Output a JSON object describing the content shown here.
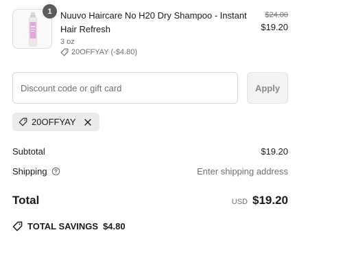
{
  "product": {
    "quantity": "1",
    "title": "Nuuvo Haircare No H20 Dry Shampoo - Instant Hair Refresh",
    "variant": "3 oz",
    "discount_line": "20OFFYAY (-$4.80)",
    "price_original": "$24.00",
    "price_current": "$19.20",
    "thumbnail_icon": "dry-shampoo-bottle"
  },
  "discount_form": {
    "placeholder": "Discount code or gift card",
    "value": "",
    "apply_label": "Apply"
  },
  "applied_code": {
    "code": "20OFFYAY",
    "remove_icon": "close-icon"
  },
  "summary": {
    "subtotal_label": "Subtotal",
    "subtotal_value": "$19.20",
    "shipping_label": "Shipping",
    "shipping_value": "Enter shipping address",
    "total_label": "Total",
    "currency": "USD",
    "total_value": "$19.20",
    "savings_label": "TOTAL SAVINGS",
    "savings_value": "$4.80"
  },
  "colors": {
    "text": "#1a1a1a",
    "muted": "#707070",
    "badge": "#5c5c5c",
    "chip_bg": "#ebebeb",
    "bottle_pink": "#e3a6d6"
  }
}
